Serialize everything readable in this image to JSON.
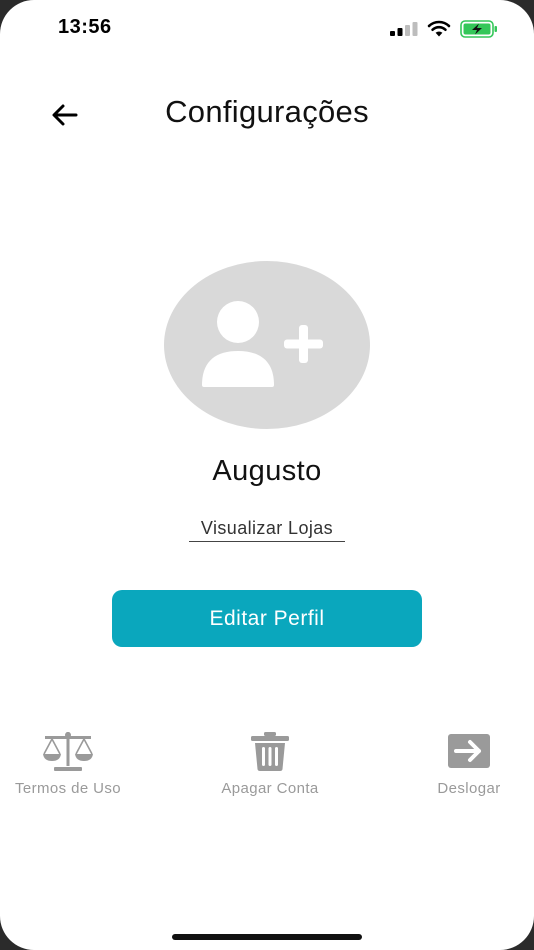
{
  "status_bar": {
    "time": "13:56",
    "signal_icon": "cellular-signal-icon",
    "wifi_icon": "wifi-icon",
    "battery_icon": "battery-charging-icon",
    "battery_color": "#34c759"
  },
  "header": {
    "back_icon": "arrow-left-icon",
    "title": "Configurações"
  },
  "profile": {
    "avatar_icon": "add-user-icon",
    "name": "Augusto",
    "view_stores_label": "Visualizar Lojas"
  },
  "edit_button": {
    "label": "Editar Perfil",
    "color": "#0aa7bd"
  },
  "actions": [
    {
      "icon": "balance-scale-icon",
      "label": "Termos de Uso"
    },
    {
      "icon": "trash-icon",
      "label": "Apagar Conta"
    },
    {
      "icon": "logout-arrow-icon",
      "label": "Deslogar"
    }
  ],
  "colors": {
    "avatar_bg": "#d9d9d9",
    "action_gray": "#9a9a9a"
  }
}
